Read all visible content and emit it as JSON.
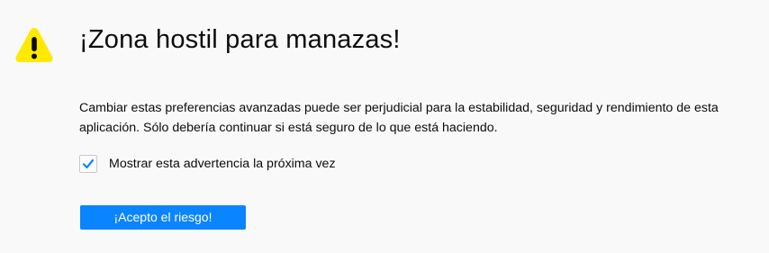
{
  "title": "¡Zona hostil para manazas!",
  "description": "Cambiar estas preferencias avanzadas puede ser perjudicial para la estabilidad, seguridad y rendimiento de esta aplicación. Sólo debería continuar si está seguro de lo que está haciendo.",
  "checkbox": {
    "label": "Mostrar esta advertencia la próxima vez",
    "checked": true
  },
  "button": {
    "label": "¡Acepto el riesgo!"
  },
  "icons": {
    "warning": "warning-icon",
    "check": "checkmark-icon"
  },
  "colors": {
    "background": "#f9f9fa",
    "accent": "#0a84ff",
    "warning": "#ffe900",
    "text": "#0c0c0d"
  }
}
